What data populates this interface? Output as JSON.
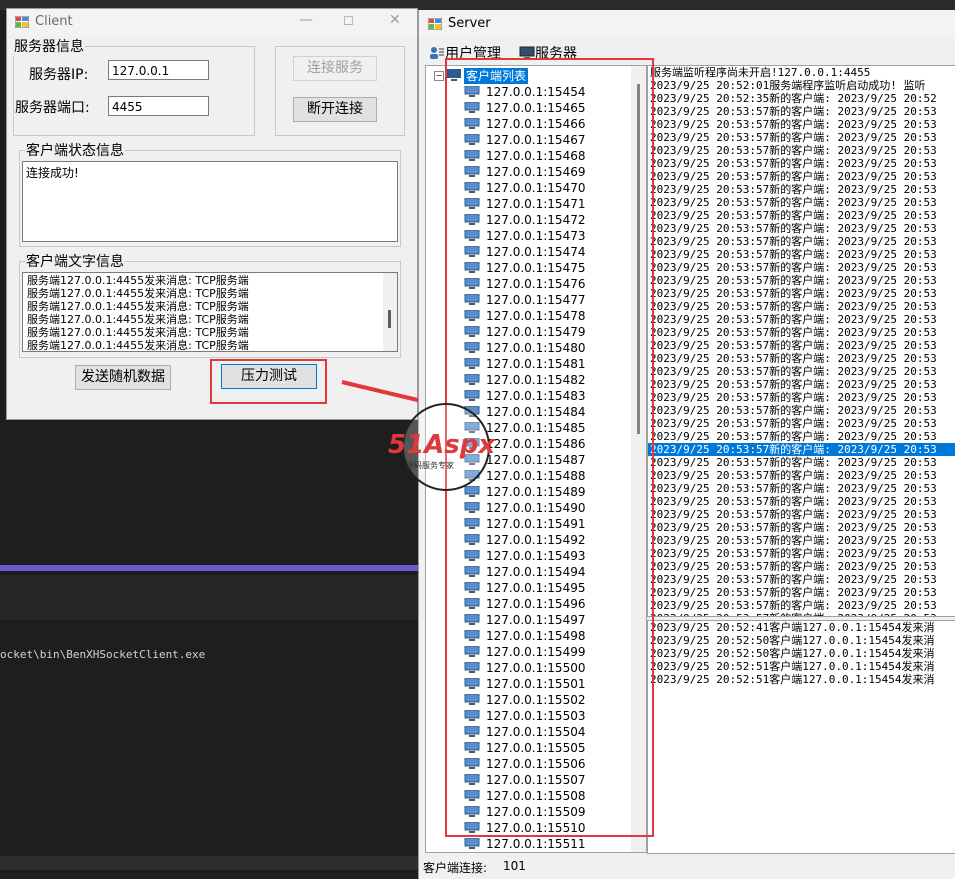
{
  "client": {
    "title": "Client",
    "server_info_group": "服务器信息",
    "ip_label": "服务器IP:",
    "ip_value": "127.0.0.1",
    "port_label": "服务器端口:",
    "port_value": "4455",
    "connect_button": "连接服务",
    "disconnect_button": "断开连接",
    "status_group": "客户端状态信息",
    "status_text": "连接成功!",
    "text_group": "客户端文字信息",
    "messages": [
      "服务端127.0.0.1:4455发来消息: TCP服务端",
      "服务端127.0.0.1:4455发来消息: TCP服务端",
      "服务端127.0.0.1:4455发来消息: TCP服务端",
      "服务端127.0.0.1:4455发来消息: TCP服务端",
      "服务端127.0.0.1:4455发来消息: TCP服务端",
      "服务端127.0.0.1:4455发来消息: TCP服务端"
    ],
    "send_random_button": "发送随机数据",
    "stress_test_button": "压力测试"
  },
  "ide": {
    "path_text": "ocket\\bin\\BenXHSocketClient.exe"
  },
  "server": {
    "title": "Server",
    "menu": [
      {
        "label": "用户管理",
        "icon": "users-icon"
      },
      {
        "label": "服务器",
        "icon": "server-icon"
      }
    ],
    "tree_root": "客户端列表",
    "clients": [
      "127.0.0.1:15454",
      "127.0.0.1:15465",
      "127.0.0.1:15466",
      "127.0.0.1:15467",
      "127.0.0.1:15468",
      "127.0.0.1:15469",
      "127.0.0.1:15470",
      "127.0.0.1:15471",
      "127.0.0.1:15472",
      "127.0.0.1:15473",
      "127.0.0.1:15474",
      "127.0.0.1:15475",
      "127.0.0.1:15476",
      "127.0.0.1:15477",
      "127.0.0.1:15478",
      "127.0.0.1:15479",
      "127.0.0.1:15480",
      "127.0.0.1:15481",
      "127.0.0.1:15482",
      "127.0.0.1:15483",
      "127.0.0.1:15484",
      "127.0.0.1:15485",
      "127.0.0.1:15486",
      "127.0.0.1:15487",
      "127.0.0.1:15488",
      "127.0.0.1:15489",
      "127.0.0.1:15490",
      "127.0.0.1:15491",
      "127.0.0.1:15492",
      "127.0.0.1:15493",
      "127.0.0.1:15494",
      "127.0.0.1:15495",
      "127.0.0.1:15496",
      "127.0.0.1:15497",
      "127.0.0.1:15498",
      "127.0.0.1:15499",
      "127.0.0.1:15500",
      "127.0.0.1:15501",
      "127.0.0.1:15502",
      "127.0.0.1:15503",
      "127.0.0.1:15504",
      "127.0.0.1:15505",
      "127.0.0.1:15506",
      "127.0.0.1:15507",
      "127.0.0.1:15508",
      "127.0.0.1:15509",
      "127.0.0.1:15510",
      "127.0.0.1:15511"
    ],
    "log_lines": [
      "服务端监听程序尚未开启!127.0.0.1:4455",
      "2023/9/25 20:52:01服务端程序监听启动成功! 监听",
      "2023/9/25 20:52:35新的客户端: 2023/9/25 20:52",
      "2023/9/25 20:53:57新的客户端: 2023/9/25 20:53",
      "2023/9/25 20:53:57新的客户端: 2023/9/25 20:53",
      "2023/9/25 20:53:57新的客户端: 2023/9/25 20:53",
      "2023/9/25 20:53:57新的客户端: 2023/9/25 20:53",
      "2023/9/25 20:53:57新的客户端: 2023/9/25 20:53",
      "2023/9/25 20:53:57新的客户端: 2023/9/25 20:53",
      "2023/9/25 20:53:57新的客户端: 2023/9/25 20:53",
      "2023/9/25 20:53:57新的客户端: 2023/9/25 20:53",
      "2023/9/25 20:53:57新的客户端: 2023/9/25 20:53",
      "2023/9/25 20:53:57新的客户端: 2023/9/25 20:53",
      "2023/9/25 20:53:57新的客户端: 2023/9/25 20:53",
      "2023/9/25 20:53:57新的客户端: 2023/9/25 20:53",
      "2023/9/25 20:53:57新的客户端: 2023/9/25 20:53",
      "2023/9/25 20:53:57新的客户端: 2023/9/25 20:53",
      "2023/9/25 20:53:57新的客户端: 2023/9/25 20:53",
      "2023/9/25 20:53:57新的客户端: 2023/9/25 20:53",
      "2023/9/25 20:53:57新的客户端: 2023/9/25 20:53",
      "2023/9/25 20:53:57新的客户端: 2023/9/25 20:53",
      "2023/9/25 20:53:57新的客户端: 2023/9/25 20:53",
      "2023/9/25 20:53:57新的客户端: 2023/9/25 20:53",
      "2023/9/25 20:53:57新的客户端: 2023/9/25 20:53",
      "2023/9/25 20:53:57新的客户端: 2023/9/25 20:53",
      "2023/9/25 20:53:57新的客户端: 2023/9/25 20:53",
      "2023/9/25 20:53:57新的客户端: 2023/9/25 20:53",
      "2023/9/25 20:53:57新的客户端: 2023/9/25 20:53",
      "2023/9/25 20:53:57新的客户端: 2023/9/25 20:53",
      "2023/9/25 20:53:57新的客户端: 2023/9/25 20:53",
      "2023/9/25 20:53:57新的客户端: 2023/9/25 20:53",
      "2023/9/25 20:53:57新的客户端: 2023/9/25 20:53",
      "2023/9/25 20:53:57新的客户端: 2023/9/25 20:53",
      "2023/9/25 20:53:57新的客户端: 2023/9/25 20:53",
      "2023/9/25 20:53:57新的客户端: 2023/9/25 20:53",
      "2023/9/25 20:53:57新的客户端: 2023/9/25 20:53",
      "2023/9/25 20:53:57新的客户端: 2023/9/25 20:53",
      "2023/9/25 20:53:57新的客户端: 2023/9/25 20:53",
      "2023/9/25 20:53:57新的客户端: 2023/9/25 20:53",
      "2023/9/25 20:53:57新的客户端: 2023/9/25 20:53",
      "2023/9/25 20:53:57新的客户端: 2023/9/25 20:53",
      "2023/9/25 20:53:57新的客户端: 2023/9/25 20:53",
      "2023/9/25 20:53:57新的客户端: 2023/9/25 20:53",
      "2023/9/25 20:53:57新的客户端: 2023/9/25 20:53"
    ],
    "selected_log_index": 29,
    "message_lines": [
      "2023/9/25 20:52:41客户端127.0.0.1:15454发来消",
      "2023/9/25 20:52:50客户端127.0.0.1:15454发来消",
      "2023/9/25 20:52:50客户端127.0.0.1:15454发来消",
      "2023/9/25 20:52:51客户端127.0.0.1:15454发来消",
      "2023/9/25 20:52:51客户端127.0.0.1:15454发来消"
    ],
    "status_label": "客户端连接:",
    "status_count": "101"
  },
  "watermark": {
    "text": "51Aspx",
    "sub": "源码服务专家"
  },
  "colors": {
    "highlight": "#e0383b",
    "selection": "#0078d7"
  }
}
